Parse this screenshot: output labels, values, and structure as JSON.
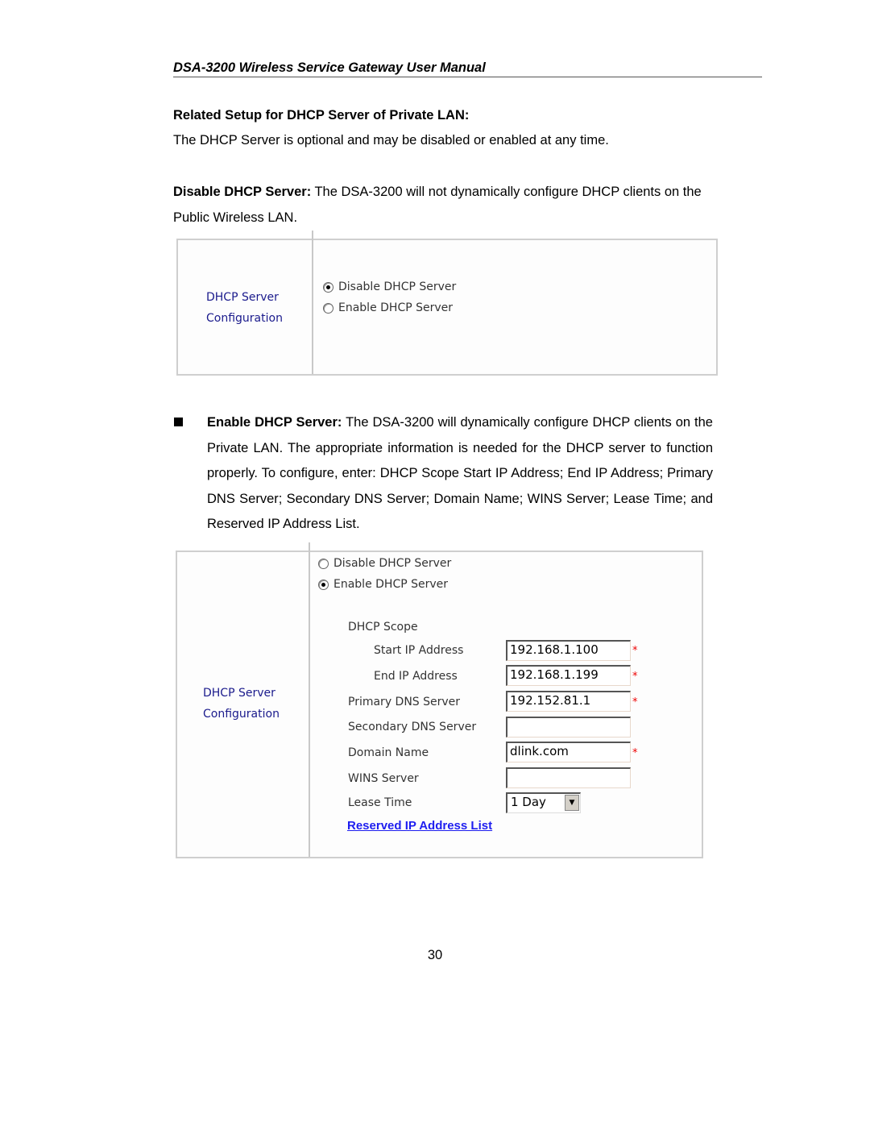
{
  "header": {
    "title": "DSA-3200 Wireless Service Gateway User Manual"
  },
  "section": {
    "title": "Related Setup for DHCP Server of Private LAN:",
    "intro": "The DHCP Server is optional and may be disabled or enabled at any time."
  },
  "disable_desc": {
    "label": "Disable DHCP Server:",
    "text": " The DSA-3200 will not dynamically configure DHCP clients on the Public Wireless LAN."
  },
  "panel1": {
    "label_line1": "DHCP Server",
    "label_line2": "Configuration",
    "options": [
      {
        "label": "Disable DHCP Server",
        "checked": true
      },
      {
        "label": "Enable  DHCP Server",
        "checked": false
      }
    ]
  },
  "enable_desc": {
    "label": "Enable DHCP Server:",
    "text": " The DSA-3200 will dynamically configure DHCP clients on the Private LAN. The appropriate information is needed for the DHCP server to function properly. To configure, enter: DHCP Scope Start IP Address; End IP Address; Primary DNS Server; Secondary DNS Server; Domain Name; WINS Server; Lease Time; and Reserved IP Address List."
  },
  "panel2": {
    "label_line1": "DHCP Server",
    "label_line2": "Configuration",
    "options": [
      {
        "label": "Disable DHCP Server",
        "checked": false
      },
      {
        "label": "Enable DHCP Server",
        "checked": true
      }
    ],
    "scope_label": "DHCP Scope",
    "fields": [
      {
        "label": "Start IP Address",
        "value": "192.168.1.100",
        "required": "*"
      },
      {
        "label": "End  IP Address",
        "value": "192.168.1.199",
        "required": "*"
      },
      {
        "label": "Primary DNS Server",
        "value": "192.152.81.1",
        "required": "*"
      },
      {
        "label": "Secondary DNS Server",
        "value": "",
        "required": ""
      },
      {
        "label": "Domain Name",
        "value": "dlink.com",
        "required": "*"
      },
      {
        "label": "WINS Server",
        "value": "",
        "required": ""
      }
    ],
    "lease_time": {
      "label": "Lease Time",
      "value": "1 Day"
    },
    "reserved_link": "Reserved IP Address List"
  },
  "footer": {
    "page_number": "30"
  }
}
